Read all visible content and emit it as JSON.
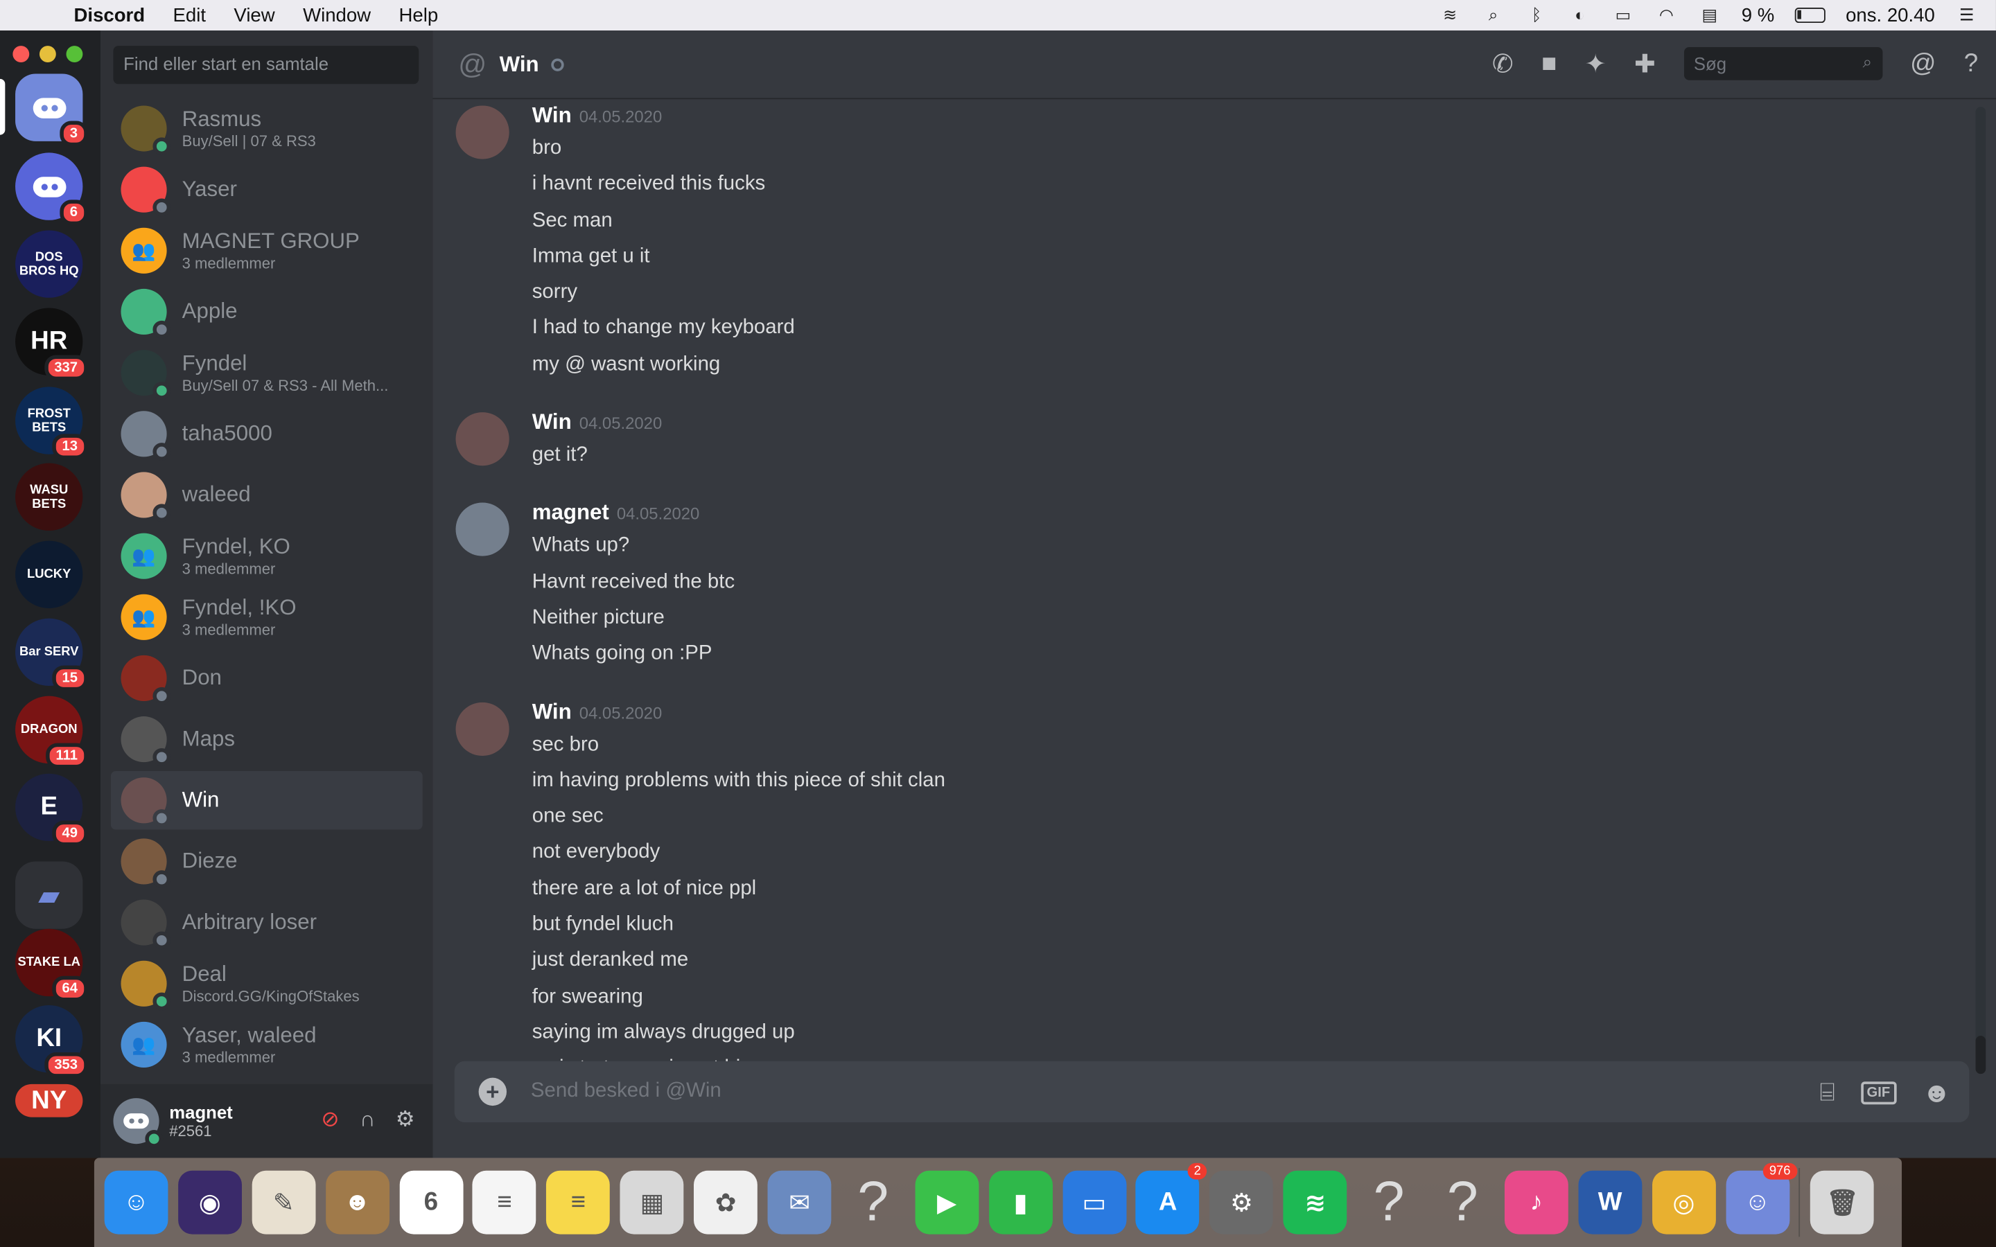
{
  "menubar": {
    "app_name": "Discord",
    "menus": [
      "Edit",
      "View",
      "Window",
      "Help"
    ],
    "battery": "9 %",
    "clock": "ons. 20.40"
  },
  "servers": [
    {
      "label": "",
      "badge": "3",
      "color": "#7289da",
      "icon": "discord-home-icon"
    },
    {
      "label": "",
      "badge": "6",
      "color": "#5865d9",
      "icon": "server-avatar-icon"
    },
    {
      "label": "DOS BROS HQ",
      "badge": "",
      "color": "#1a1f5c",
      "icon": "server-logo"
    },
    {
      "label": "HR",
      "badge": "337",
      "color": "#101010",
      "icon": "server-logo"
    },
    {
      "label": "FROST BETS",
      "badge": "13",
      "color": "#0c2a55",
      "icon": "server-logo"
    },
    {
      "label": "WASU BETS",
      "badge": "",
      "color": "#3a0f0f",
      "icon": "server-logo"
    },
    {
      "label": "LUCKY",
      "badge": "",
      "color": "#0d1b30",
      "icon": "server-logo"
    },
    {
      "label": "Bar SERV",
      "badge": "15",
      "color": "#1b2a55",
      "icon": "server-logo"
    },
    {
      "label": "DRAGON",
      "badge": "111",
      "color": "#7a1414",
      "icon": "server-logo"
    },
    {
      "label": "E",
      "badge": "49",
      "color": "#1c2140",
      "icon": "server-logo"
    },
    {
      "label": "",
      "badge": "",
      "color": "#2f3136",
      "icon": "folder-icon"
    },
    {
      "label": "STAKE LA",
      "badge": "64",
      "color": "#5a0d0d",
      "icon": "server-logo"
    },
    {
      "label": "KI",
      "badge": "353",
      "color": "#16284a",
      "icon": "server-logo"
    },
    {
      "label": "NY",
      "badge": "",
      "color": "#d64030",
      "icon": "new-indicator"
    }
  ],
  "dm_search_placeholder": "Find eller start en samtale",
  "dms": [
    {
      "name": "Rasmus",
      "sub": "Buy/Sell | 07 & RS3",
      "color": "#6a5a2a",
      "status": "online",
      "active": false
    },
    {
      "name": "Yaser",
      "sub": "",
      "color": "#f04747",
      "status": "offline",
      "active": false
    },
    {
      "name": "MAGNET GROUP",
      "sub": "3 medlemmer",
      "color": "#faa61a",
      "status": "",
      "active": false
    },
    {
      "name": "Apple",
      "sub": "",
      "color": "#43b581",
      "status": "offline",
      "active": false
    },
    {
      "name": "Fyndel",
      "sub": "Buy/Sell 07 & RS3 - All Meth...",
      "color": "#2a3a3a",
      "status": "online",
      "active": false
    },
    {
      "name": "taha5000",
      "sub": "",
      "color": "#747f8d",
      "status": "offline",
      "active": false
    },
    {
      "name": "waleed",
      "sub": "",
      "color": "#c79a80",
      "status": "offline",
      "active": false
    },
    {
      "name": "Fyndel, KO",
      "sub": "3 medlemmer",
      "color": "#43b581",
      "status": "",
      "active": false
    },
    {
      "name": "Fyndel, !KO",
      "sub": "3 medlemmer",
      "color": "#faa61a",
      "status": "",
      "active": false
    },
    {
      "name": "Don",
      "sub": "",
      "color": "#8a2a20",
      "status": "offline",
      "active": false
    },
    {
      "name": "Maps",
      "sub": "",
      "color": "#555",
      "status": "offline",
      "active": false
    },
    {
      "name": "Win",
      "sub": "",
      "color": "#6a5050",
      "status": "offline",
      "active": true
    },
    {
      "name": "Dieze",
      "sub": "",
      "color": "#7a5a40",
      "status": "offline",
      "active": false
    },
    {
      "name": "Arbitrary loser",
      "sub": "",
      "color": "#444",
      "status": "offline",
      "active": false
    },
    {
      "name": "Deal",
      "sub": "Discord.GG/KingOfStakes",
      "color": "#b8862a",
      "status": "online",
      "active": false
    },
    {
      "name": "Yaser, waleed",
      "sub": "3 medlemmer",
      "color": "#4a8fd6",
      "status": "",
      "active": false
    }
  ],
  "user": {
    "name": "magnet",
    "tag": "#2561"
  },
  "chat": {
    "title": "Win",
    "search_placeholder": "Søg",
    "composer_placeholder": "Send besked i @Win",
    "gif_label": "GIF",
    "groups": [
      {
        "author": "Win",
        "ts": "04.05.2020",
        "avatar_color": "#6a5050",
        "lines": [
          "bro",
          "i havnt received this fucks",
          "Sec man",
          "Imma get u it",
          "sorry",
          "I had to change my keyboard",
          "my @ wasnt working"
        ]
      },
      {
        "author": "Win",
        "ts": "04.05.2020",
        "avatar_color": "#6a5050",
        "lines": [
          "get it?"
        ]
      },
      {
        "author": "magnet",
        "ts": "04.05.2020",
        "avatar_color": "#747f8d",
        "lines": [
          "Whats up?",
          "Havnt received the btc",
          "Neither picture",
          "Whats going on :PP"
        ]
      },
      {
        "author": "Win",
        "ts": "04.05.2020",
        "avatar_color": "#6a5050",
        "lines": [
          "sec bro",
          "im having problems with this piece of shit clan",
          "one sec",
          "not everybody",
          "there are a lot of nice ppl",
          "but fyndel kluch",
          "just deranked me",
          "for swearing",
          "saying im always drugged up",
          "so i start swearing at him"
        ]
      }
    ]
  },
  "dock": [
    {
      "name": "Finder",
      "color": "#2a8ef0",
      "glyph": "☺",
      "badge": ""
    },
    {
      "name": "Siri",
      "color": "#3a2a6a",
      "glyph": "◉",
      "badge": ""
    },
    {
      "name": "Preview",
      "color": "#e8e0d0",
      "glyph": "✎",
      "badge": ""
    },
    {
      "name": "Contacts",
      "color": "#a07a4a",
      "glyph": "☻",
      "badge": ""
    },
    {
      "name": "Calendar",
      "color": "#ffffff",
      "glyph": "6",
      "badge": ""
    },
    {
      "name": "Reminders",
      "color": "#f5f5f5",
      "glyph": "≡",
      "badge": ""
    },
    {
      "name": "Notes",
      "color": "#f7d84a",
      "glyph": "≡",
      "badge": ""
    },
    {
      "name": "Image Capture",
      "color": "#d8d8d8",
      "glyph": "▦",
      "badge": ""
    },
    {
      "name": "Photos",
      "color": "#f0f0f0",
      "glyph": "✿",
      "badge": ""
    },
    {
      "name": "Mail",
      "color": "#6a8ac0",
      "glyph": "✉",
      "badge": ""
    },
    {
      "name": "Unknown",
      "color": "transparent",
      "glyph": "?",
      "badge": ""
    },
    {
      "name": "FaceTime",
      "color": "#3ac04a",
      "glyph": "▶",
      "badge": ""
    },
    {
      "name": "Numbers",
      "color": "#2fb84a",
      "glyph": "▮",
      "badge": ""
    },
    {
      "name": "Keynote",
      "color": "#2a7ae0",
      "glyph": "▭",
      "badge": ""
    },
    {
      "name": "App Store",
      "color": "#1a8af0",
      "glyph": "A",
      "badge": "2"
    },
    {
      "name": "System Preferences",
      "color": "#6a6a6a",
      "glyph": "⚙",
      "badge": ""
    },
    {
      "name": "Spotify",
      "color": "#1db954",
      "glyph": "≋",
      "badge": ""
    },
    {
      "name": "Unknown",
      "color": "transparent",
      "glyph": "?",
      "badge": ""
    },
    {
      "name": "Unknown",
      "color": "transparent",
      "glyph": "?",
      "badge": ""
    },
    {
      "name": "iTunes",
      "color": "#e84a8a",
      "glyph": "♪",
      "badge": ""
    },
    {
      "name": "Word",
      "color": "#2a5aa8",
      "glyph": "W",
      "badge": ""
    },
    {
      "name": "Chrome",
      "color": "#e8b030",
      "glyph": "◎",
      "badge": ""
    },
    {
      "name": "Discord",
      "color": "#7289da",
      "glyph": "☺",
      "badge": "976"
    },
    {
      "name": "Trash",
      "color": "#d8d8d8",
      "glyph": "🗑",
      "badge": ""
    }
  ]
}
